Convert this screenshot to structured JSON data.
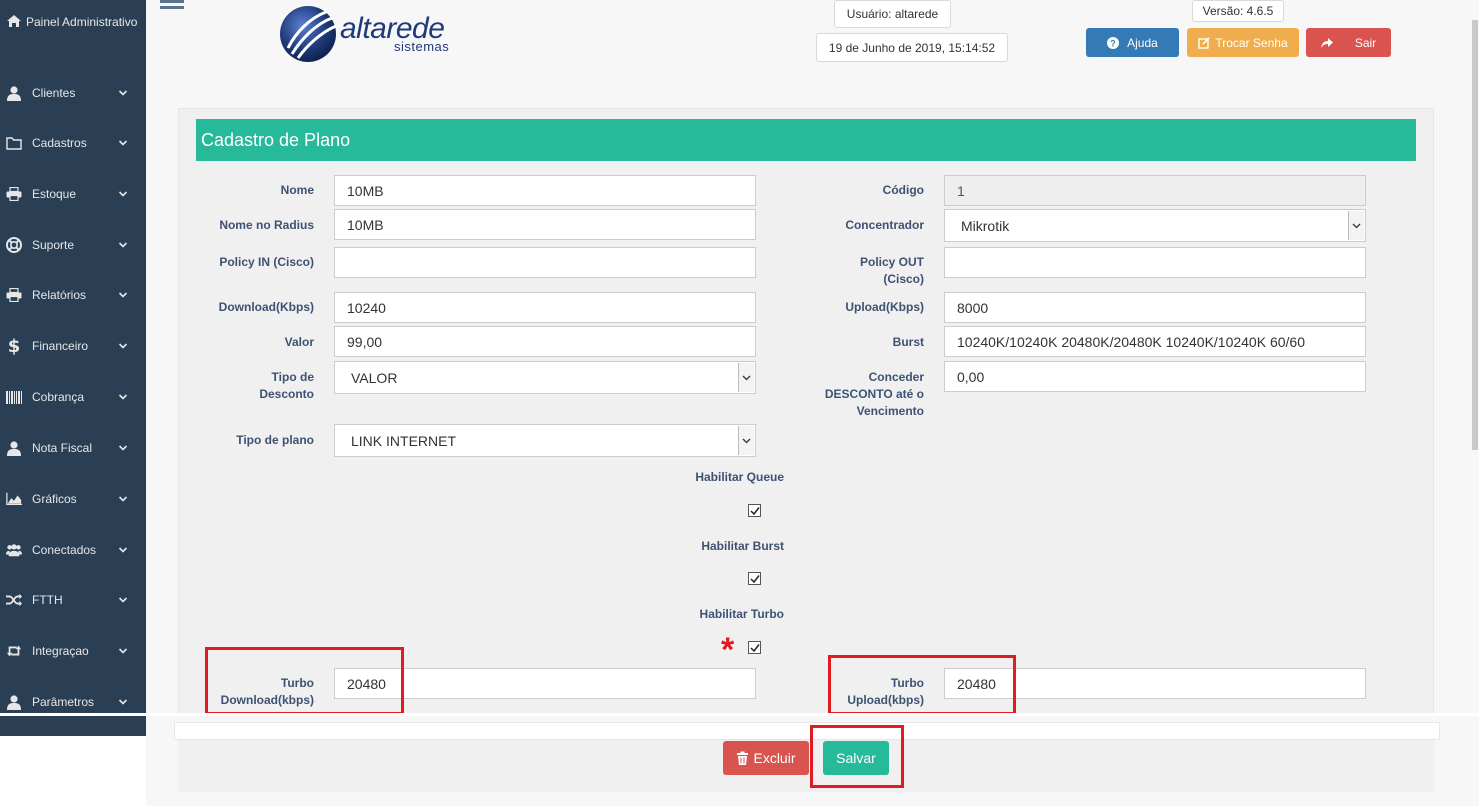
{
  "sidebar": {
    "header": "Painel Administrativo",
    "items": [
      {
        "label": "Clientes",
        "icon": "user-icon"
      },
      {
        "label": "Cadastros",
        "icon": "folder-icon"
      },
      {
        "label": "Estoque",
        "icon": "print-icon"
      },
      {
        "label": "Suporte",
        "icon": "lifebuoy-icon"
      },
      {
        "label": "Relatórios",
        "icon": "print-icon"
      },
      {
        "label": "Financeiro",
        "icon": "dollar-icon"
      },
      {
        "label": "Cobrança",
        "icon": "barcode-icon"
      },
      {
        "label": "Nota Fiscal",
        "icon": "user-icon"
      },
      {
        "label": "Gráficos",
        "icon": "area-chart-icon"
      },
      {
        "label": "Conectados",
        "icon": "users-icon"
      },
      {
        "label": "FTTH",
        "icon": "shuffle-icon"
      },
      {
        "label": "Integraçao",
        "icon": "retweet-icon"
      },
      {
        "label": "Parâmetros",
        "icon": "user-icon"
      }
    ]
  },
  "header": {
    "logo_text": "altarede",
    "logo_sub": "sistemas",
    "user": "Usuário: altarede",
    "datetime": "19 de Junho de 2019, 15:14:52",
    "version": "Versão: 4.6.5",
    "help_label": "Ajuda",
    "change_password_label": "Trocar Senha",
    "logout_label": "Sair"
  },
  "form": {
    "title": "Cadastro de Plano",
    "nome_label": "Nome",
    "nome_value": "10MB",
    "radius_label": "Nome no Radius",
    "radius_value": "10MB",
    "policy_in_label": "Policy IN (Cisco)",
    "policy_in_value": "",
    "download_label": "Download(Kbps)",
    "download_value": "10240",
    "valor_label": "Valor",
    "valor_value": "99,00",
    "tipo_desconto_label_1": "Tipo de",
    "tipo_desconto_label_2": "Desconto",
    "tipo_desconto_value": "VALOR",
    "tipo_plano_label": "Tipo de plano",
    "tipo_plano_value": "LINK INTERNET",
    "codigo_label": "Código",
    "codigo_value": "1",
    "concentrador_label": "Concentrador",
    "concentrador_value": "Mikrotik",
    "policy_out_label_1": "Policy OUT",
    "policy_out_label_2": "(Cisco)",
    "policy_out_value": "",
    "upload_label": "Upload(Kbps)",
    "upload_value": "8000",
    "burst_label": "Burst",
    "burst_value": "10240K/10240K 20480K/20480K 10240K/10240K 60/60",
    "conceder_label_1": "Conceder",
    "conceder_label_2": "DESCONTO até o",
    "conceder_label_3": "Vencimento",
    "conceder_value": "0,00",
    "queue_label": "Habilitar Queue",
    "burst_enable_label": "Habilitar Burst",
    "turbo_enable_label": "Habilitar Turbo",
    "turbo_download_label_1": "Turbo",
    "turbo_download_label_2": "Download(kbps)",
    "turbo_download_value": "20480",
    "turbo_upload_label_1": "Turbo",
    "turbo_upload_label_2": "Upload(kbps)",
    "turbo_upload_value": "20480"
  },
  "footer": {
    "delete_label": "Excluir",
    "save_label": "Salvar"
  },
  "colors": {
    "sidebar": "#2a3f54",
    "accent": "#26b99a",
    "help": "#337ab7",
    "warning": "#f0ad4e",
    "danger": "#d9534f",
    "highlight": "#e11b22"
  }
}
